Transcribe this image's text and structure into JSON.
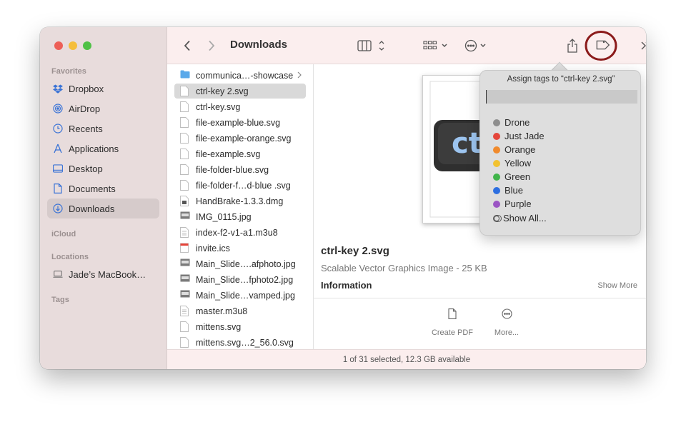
{
  "window": {
    "title": "Downloads"
  },
  "sidebar": {
    "sections": {
      "favorites": "Favorites",
      "icloud": "iCloud",
      "locations": "Locations",
      "tags": "Tags"
    },
    "items": [
      {
        "label": "Dropbox",
        "icon": "dropbox-icon"
      },
      {
        "label": "AirDrop",
        "icon": "airdrop-icon"
      },
      {
        "label": "Recents",
        "icon": "clock-icon"
      },
      {
        "label": "Applications",
        "icon": "applications-icon"
      },
      {
        "label": "Desktop",
        "icon": "desktop-icon"
      },
      {
        "label": "Documents",
        "icon": "document-icon"
      },
      {
        "label": "Downloads",
        "icon": "download-icon",
        "selected": true
      }
    ],
    "locations": [
      {
        "label": "Jade’s MacBook…",
        "icon": "laptop-icon"
      }
    ]
  },
  "files": [
    {
      "name": "communica…-showcase",
      "kind": "folder"
    },
    {
      "name": "ctrl-key 2.svg",
      "kind": "doc",
      "selected": true
    },
    {
      "name": "ctrl-key.svg",
      "kind": "doc"
    },
    {
      "name": "file-example-blue.svg",
      "kind": "doc"
    },
    {
      "name": "file-example-orange.svg",
      "kind": "doc"
    },
    {
      "name": "file-example.svg",
      "kind": "doc"
    },
    {
      "name": "file-folder-blue.svg",
      "kind": "doc"
    },
    {
      "name": "file-folder-f…d-blue .svg",
      "kind": "doc"
    },
    {
      "name": "HandBrake-1.3.3.dmg",
      "kind": "dmg"
    },
    {
      "name": "IMG_0115.jpg",
      "kind": "image"
    },
    {
      "name": "index-f2-v1-a1.m3u8",
      "kind": "text"
    },
    {
      "name": "invite.ics",
      "kind": "calendar"
    },
    {
      "name": "Main_Slide….afphoto.jpg",
      "kind": "image"
    },
    {
      "name": "Main_Slide…fphoto2.jpg",
      "kind": "image"
    },
    {
      "name": "Main_Slide…vamped.jpg",
      "kind": "image"
    },
    {
      "name": "master.m3u8",
      "kind": "text"
    },
    {
      "name": "mittens.svg",
      "kind": "doc"
    },
    {
      "name": "mittens.svg…2_56.0.svg",
      "kind": "doc"
    }
  ],
  "preview": {
    "thumb_text": "ct",
    "filename": "ctrl-key 2.svg",
    "subtitle": "Scalable Vector Graphics Image - 25 KB",
    "info_label": "Information",
    "show_more": "Show More",
    "actions": [
      {
        "label": "Create PDF",
        "icon": "pdf-document-icon"
      },
      {
        "label": "More...",
        "icon": "ellipsis-circle-icon"
      }
    ]
  },
  "status": "1 of 31 selected, 12.3 GB available",
  "tags_popover": {
    "title": "Assign tags to “ctrl-key 2.svg”",
    "input_value": "",
    "tags": [
      {
        "label": "Drone",
        "color": "#8e8e8e"
      },
      {
        "label": "Just Jade",
        "color": "#e5453a"
      },
      {
        "label": "Orange",
        "color": "#f08a2c"
      },
      {
        "label": "Yellow",
        "color": "#f2c230"
      },
      {
        "label": "Green",
        "color": "#40b44a"
      },
      {
        "label": "Blue",
        "color": "#2d6fe0"
      },
      {
        "label": "Purple",
        "color": "#9b55c4"
      }
    ],
    "show_all": "Show All..."
  },
  "colors": {
    "highlight_circle": "#8b1a1a",
    "accent": "#3a73d6"
  }
}
